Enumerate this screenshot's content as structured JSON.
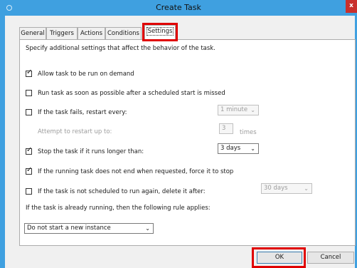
{
  "window": {
    "title": "Create Task",
    "close_label": "x"
  },
  "tabs": [
    {
      "label": "General"
    },
    {
      "label": "Triggers"
    },
    {
      "label": "Actions"
    },
    {
      "label": "Conditions"
    },
    {
      "label": "Settings"
    }
  ],
  "settings": {
    "description": "Specify additional settings that affect the behavior of the task.",
    "allow_on_demand": {
      "label": "Allow task to be run on demand",
      "checked": true
    },
    "run_asap": {
      "label": "Run task as soon as possible after a scheduled start is missed",
      "checked": false
    },
    "restart_if_fails": {
      "label": "If the task fails, restart every:",
      "checked": false,
      "interval": "1 minute"
    },
    "restart_attempts": {
      "label": "Attempt to restart up to:",
      "value": "3",
      "unit": "times"
    },
    "stop_if_longer": {
      "label": "Stop the task if it runs longer than:",
      "checked": true,
      "duration": "3 days"
    },
    "force_stop": {
      "label": "If the running task does not end when requested, force it to stop",
      "checked": true
    },
    "delete_after": {
      "label": "If the task is not scheduled to run again, delete it after:",
      "checked": false,
      "duration": "30 days"
    },
    "rule_label": "If the task is already running, then the following rule applies:",
    "rule_value": "Do not start a new instance"
  },
  "buttons": {
    "ok": "OK",
    "cancel": "Cancel"
  },
  "icons": {
    "dropdown": "chevron-down-icon",
    "check": "checkmark-icon"
  }
}
